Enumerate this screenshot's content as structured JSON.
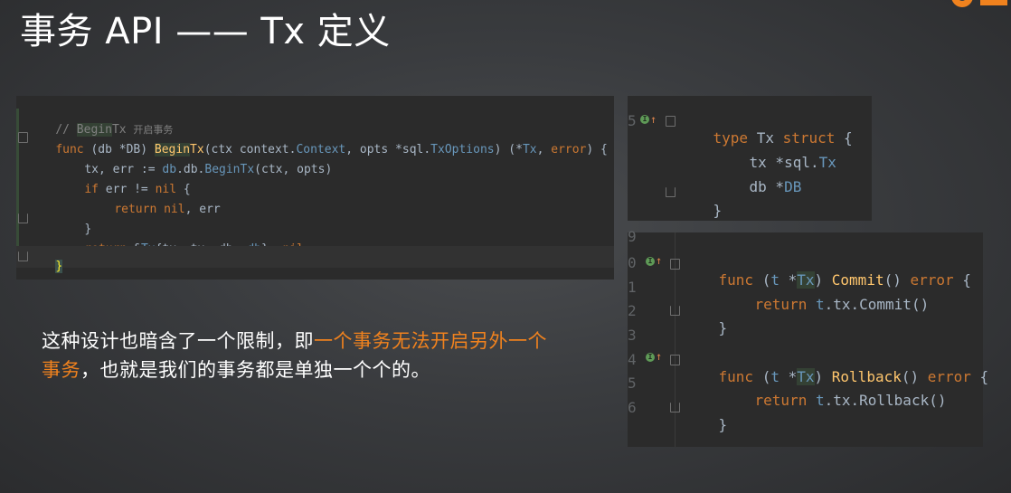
{
  "slide": {
    "title": "事务 API —— Tx 定义",
    "brand_color": "#f0821e"
  },
  "panel_begin_tx": {
    "comment_prefix": "// ",
    "comment_fn": "Begin",
    "comment_fn_rest": "Tx ",
    "comment_zh": "开启事务",
    "line1": {
      "func": "func ",
      "recv": "(db *DB) ",
      "name_hl": "Begin",
      "name_rest": "Tx",
      "params": "(ctx context.",
      "ctx_type": "Context",
      "params2": ", opts *sql.",
      "opts_type": "TxOptions",
      "params3": ") (*",
      "ret_type": "Tx",
      "ret_rest": ", ",
      "err_kw": "error",
      "close": ") {"
    },
    "line2": {
      "a": "tx, err := ",
      "b": "db",
      "c": ".db.",
      "d": "BeginTx",
      "e": "(ctx, opts)"
    },
    "line3": {
      "kw": "if ",
      "a": "err != ",
      "nil": "nil",
      "b": " {"
    },
    "line4": {
      "kw": "return ",
      "nil": "nil",
      "b": ", err"
    },
    "line5": "}",
    "line6": {
      "kw": "return ",
      "a": "&",
      "t": "Tx",
      "b": "{tx: tx, db: ",
      "db": "db",
      "c": "}, ",
      "nil": "nil"
    },
    "line7": "}"
  },
  "panel_struct": {
    "gutter": [
      "5",
      "",
      "",
      ""
    ],
    "line1": {
      "kw": "type ",
      "name": "Tx ",
      "kw2": "struct",
      "b": " {"
    },
    "line2": {
      "a": "tx *sql.",
      "t": "Tx"
    },
    "line3": {
      "a": "db *",
      "t": "DB"
    },
    "line4": "}"
  },
  "panel_methods": {
    "gutter": [
      "9",
      "0",
      "1",
      "2",
      "3",
      "4",
      "5",
      "6"
    ],
    "commit_sig": {
      "kw": "func ",
      "a": "(",
      "t": "t",
      "b": " *",
      "type": "Tx",
      "c": ") ",
      "fn": "Commit",
      "d": "() ",
      "err": "error",
      "e": " {"
    },
    "commit_body": {
      "kw": "return ",
      "t": "t",
      "a": ".tx.Commit()"
    },
    "close1": "}",
    "rollback_sig": {
      "kw": "func ",
      "a": "(",
      "t": "t",
      "b": " *",
      "type": "Tx",
      "c": ") ",
      "fn": "Rollback",
      "d": "() ",
      "err": "error",
      "e": " {"
    },
    "rollback_body": {
      "kw": "return ",
      "t": "t",
      "a": ".tx.Rollback()"
    },
    "close2": "}"
  },
  "description": {
    "part1": "这种设计也暗含了一个限制，即",
    "accent": "一个事务无法开启另外一个事务",
    "part2": "，也就是我们的事务都是单独一个个的。"
  }
}
